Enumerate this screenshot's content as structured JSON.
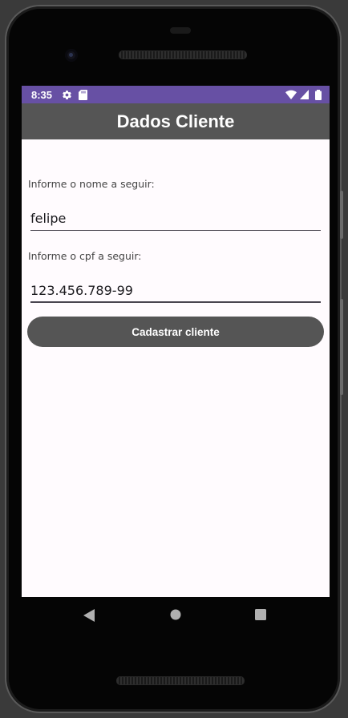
{
  "status_bar": {
    "time": "8:35",
    "icons": [
      "gear-icon",
      "sd-card-icon",
      "wifi-icon",
      "signal-icon",
      "battery-icon"
    ],
    "color": "#6750a4"
  },
  "app_bar": {
    "title": "Dados Cliente",
    "color": "#555555"
  },
  "form": {
    "name_label": "Informe o nome a seguir:",
    "name_value": "felipe",
    "cpf_label": "Informe o cpf a seguir:",
    "cpf_value": "123.456.789-99",
    "submit_label": "Cadastrar cliente"
  },
  "nav_bar": {
    "buttons": [
      "back-icon",
      "home-icon",
      "recents-icon"
    ]
  }
}
